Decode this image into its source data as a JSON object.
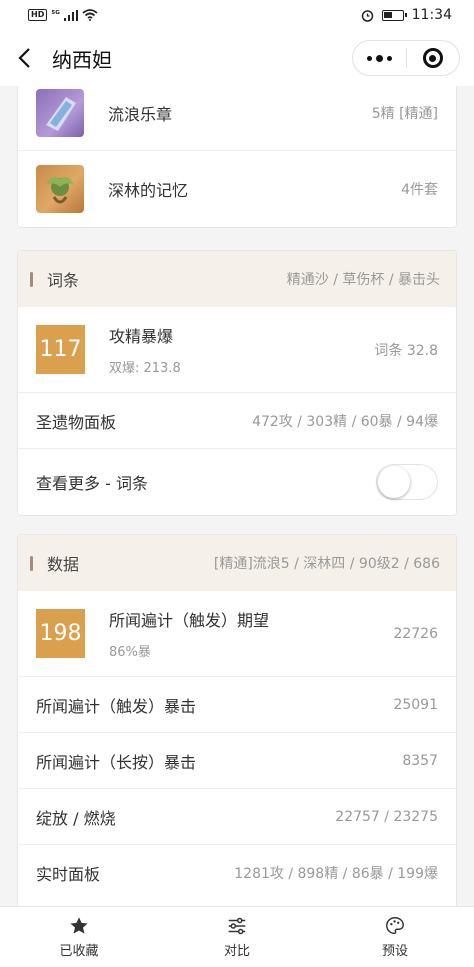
{
  "status_bar": {
    "left": "HD ⁵ᴳ",
    "time": "11:34"
  },
  "nav": {
    "title": "纳西妲"
  },
  "weapon_card": {
    "items": [
      {
        "name": "流浪乐章",
        "detail": "5精 [精通]"
      },
      {
        "name": "深林的记忆",
        "detail": "4件套"
      }
    ]
  },
  "stats_card": {
    "header": {
      "title": "词条",
      "summary": "精通沙 / 草伤杯 / 暴击头"
    },
    "score": {
      "value": "117",
      "title": "攻精暴爆",
      "sub": "双爆: 213.8",
      "right": "词条 32.8"
    },
    "rows": [
      {
        "label": "圣遗物面板",
        "value": "472攻 / 303精 / 60暴 / 94爆"
      }
    ],
    "toggle": {
      "label": "查看更多 - 词条",
      "on": false
    }
  },
  "data_card": {
    "header": {
      "title": "数据",
      "summary": "[精通]流浪5 / 深林四 / 90级2 / 686"
    },
    "score": {
      "value": "198",
      "title": "所闻遍计（触发）期望",
      "sub": "86%暴",
      "right": "22726"
    },
    "rows": [
      {
        "label": "所闻遍计（触发）暴击",
        "value": "25091"
      },
      {
        "label": "所闻遍计（长按）暴击",
        "value": "8357"
      },
      {
        "label": "绽放 / 燃烧",
        "value": "22757 / 23275"
      },
      {
        "label": "实时面板",
        "value": "1281攻 / 898精 / 86暴 / 199爆"
      }
    ]
  },
  "tabbar": {
    "tabs": [
      {
        "label": "已收藏",
        "icon": "star-icon"
      },
      {
        "label": "对比",
        "icon": "sliders-icon"
      },
      {
        "label": "预设",
        "icon": "palette-icon"
      }
    ]
  },
  "colors": {
    "badge": "#dba04e",
    "header_bg": "#f5f1ea",
    "header_bar": "#a88a78"
  }
}
